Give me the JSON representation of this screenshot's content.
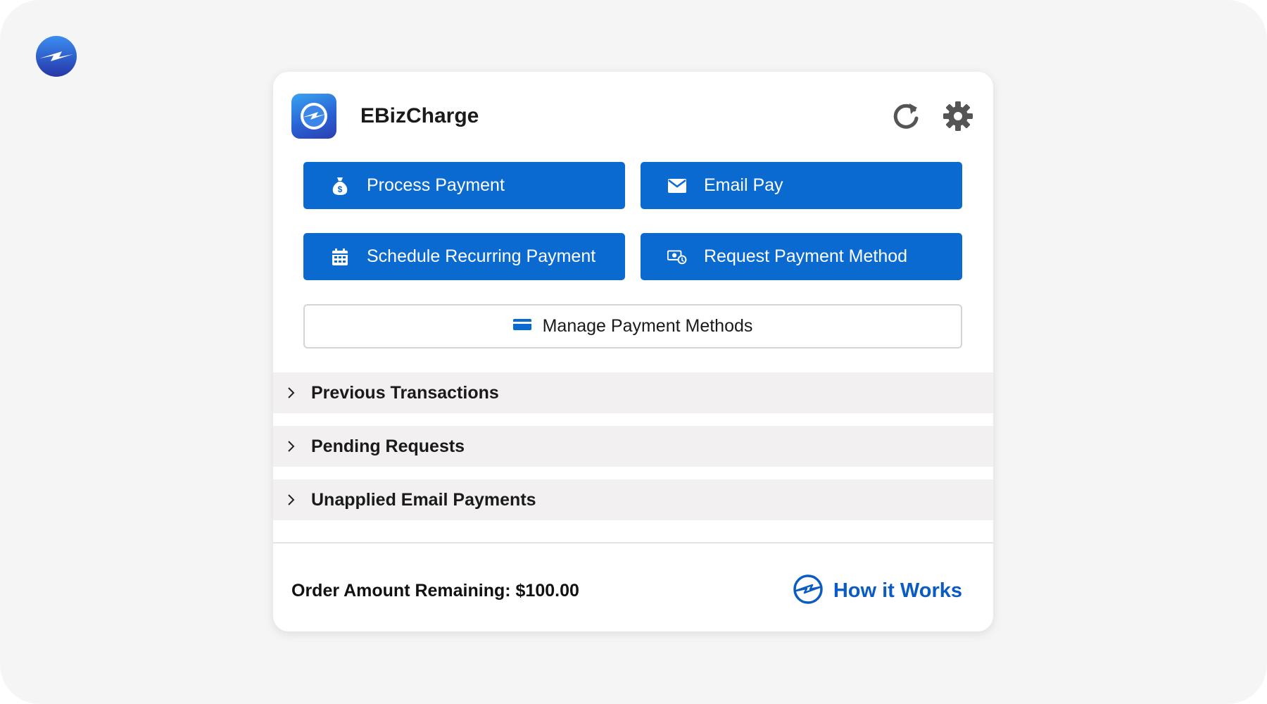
{
  "app": {
    "title": "EBizCharge",
    "icon": "ebizcharge-logo-icon"
  },
  "header": {
    "refresh_icon": "refresh-icon",
    "settings_icon": "gear-icon"
  },
  "actions": [
    {
      "label": "Process Payment",
      "icon": "money-bag-icon"
    },
    {
      "label": "Email Pay",
      "icon": "envelope-icon"
    },
    {
      "label": "Schedule Recurring Payment",
      "icon": "calendar-icon"
    },
    {
      "label": "Request Payment Method",
      "icon": "payment-request-icon"
    }
  ],
  "manage": {
    "label": "Manage Payment Methods",
    "icon": "credit-card-icon"
  },
  "sections": [
    {
      "label": "Previous Transactions"
    },
    {
      "label": "Pending Requests"
    },
    {
      "label": "Unapplied Email Payments"
    }
  ],
  "footer": {
    "order_amount": "Order Amount Remaining: $100.00",
    "how_label": "How it Works"
  },
  "colors": {
    "primary": "#0a6ad0",
    "link": "#0a5cc2",
    "section_bg": "#f2f0f1",
    "background": "#f5f5f6"
  }
}
